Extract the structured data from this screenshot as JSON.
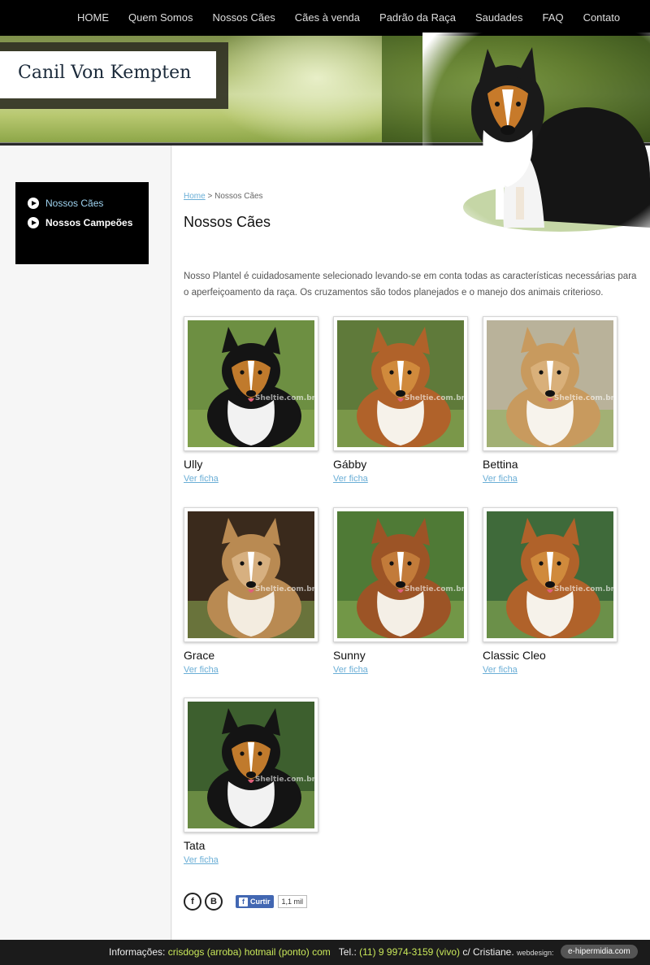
{
  "nav": {
    "items": [
      "HOME",
      "Quem Somos",
      "Nossos Cães",
      "Cães à venda",
      "Padrão da Raça",
      "Saudades",
      "FAQ",
      "Contato"
    ]
  },
  "brand": {
    "title": "Canil Von Kempten"
  },
  "sidebar": {
    "items": [
      {
        "label": "Nossos Cães",
        "active": true
      },
      {
        "label": "Nossos Campeões",
        "active": false
      }
    ]
  },
  "breadcrumb": {
    "home": "Home",
    "separator": " > ",
    "current": "Nossos Cães"
  },
  "page": {
    "title": "Nossos Cães",
    "intro": "Nosso Plantel é cuidadosamente selecionado levando-se em conta todas as características necessárias para o aperfeiçoamento da raça. Os cruzamentos são todos planejados e o manejo dos animais criterioso."
  },
  "watermark": "Sheltie.com.br",
  "dogs": [
    {
      "name": "Ully",
      "link": "Ver ficha",
      "coat": "tricolor",
      "bg": "#6d8f42"
    },
    {
      "name": "Gábby",
      "link": "Ver ficha",
      "coat": "sable",
      "bg": "#5f7a3a"
    },
    {
      "name": "Bettina",
      "link": "Ver ficha",
      "coat": "sable-light",
      "bg": "#b9b29a"
    },
    {
      "name": "Grace",
      "link": "Ver ficha",
      "coat": "puppy",
      "bg": "#3a2a1c"
    },
    {
      "name": "Sunny",
      "link": "Ver ficha",
      "coat": "sable-side",
      "bg": "#4f7a36"
    },
    {
      "name": "Classic Cleo",
      "link": "Ver ficha",
      "coat": "sable",
      "bg": "#3f6a3a"
    },
    {
      "name": "Tata",
      "link": "Ver ficha",
      "coat": "tricolor",
      "bg": "#3d5f2e"
    }
  ],
  "social": {
    "facebook_icon": "f",
    "blogger_icon": "B",
    "like_label": "Curtir",
    "like_count": "1,1 mil"
  },
  "footer": {
    "info_label": "Informações: ",
    "email": "crisdogs (arroba) hotmail (ponto) com",
    "tel_label": "Tel.: ",
    "phone": "(11) 9 9974-3159 (vivo)",
    "tel_suffix": " c/ Cristiane.",
    "webdesign_label": "webdesign:",
    "webdesign_name": "e-hipermidia.com"
  },
  "colors": {
    "accent_link": "#6aaed6",
    "footer_highlight": "#c9e85a",
    "nav_bg": "#000000"
  }
}
